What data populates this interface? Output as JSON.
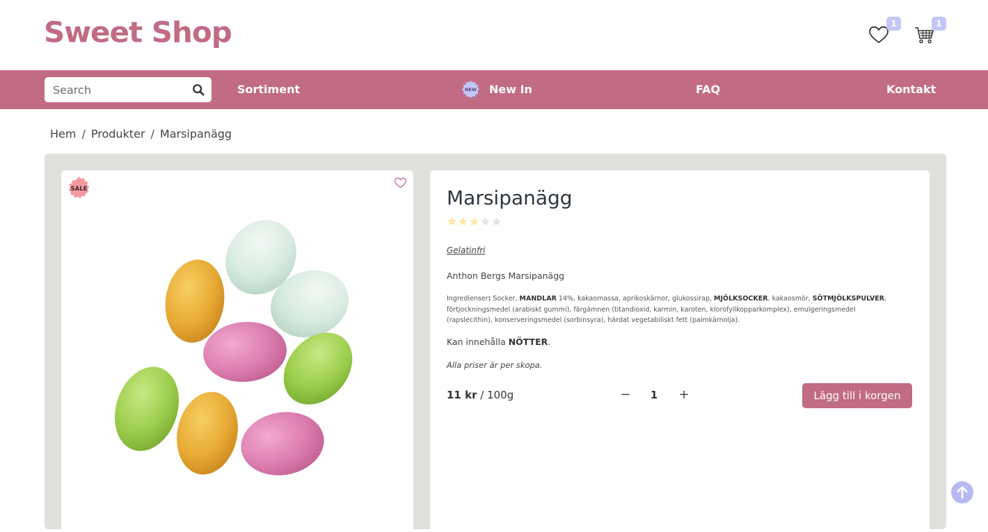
{
  "brand": {
    "name": "Sweet Shop",
    "color": "#c16b84"
  },
  "header": {
    "wishlist_count": "1",
    "cart_count": "1"
  },
  "nav": {
    "search_placeholder": "Search",
    "links": [
      "Sortiment",
      "New In",
      "FAQ",
      "Kontakt"
    ],
    "new_badge": "NEW"
  },
  "breadcrumb": [
    "Hem",
    "Produkter",
    "Marsipanägg"
  ],
  "product": {
    "sale_badge": "SALE",
    "title": "Marsipanägg",
    "rating": 3,
    "rating_max": 5,
    "tag": "Gelatinfri",
    "description": "Anthon Bergs Marsipanägg",
    "ingredients_label": "Ingredienser",
    "ingredients_parts": [
      "Socker, ",
      "MANDLAR",
      " 14%, kakaomassa, aprikoskärnor, glukossirap, ",
      "MJÖLKSOCKER",
      ", kakaosmör, ",
      "SÖTMJÖLKSPULVER",
      ", förtjockningsmedel (arabiskt gummi), färgämnen (titandioxid, karmin, karoten, klorofyllkopparkomplex), emulgeringsmedel (rapslecithin), konserveringsmedel (sorbinsyra), härdat vegetabiliskt fett (palmkärnolja)."
    ],
    "allergy_prefix": "Kan innehålla ",
    "allergy_bold": "NÖTTER",
    "allergy_suffix": ".",
    "price_note": "Alla priser är per skopa.",
    "price_value": "11 kr",
    "price_unit": " / 100g",
    "quantity": "1",
    "add_to_cart_label": "Lägg till i korgen"
  },
  "icons": {
    "wishlist": "heart-icon",
    "cart": "cart-icon",
    "search": "search-icon",
    "scroll_top": "arrow-up-icon"
  }
}
